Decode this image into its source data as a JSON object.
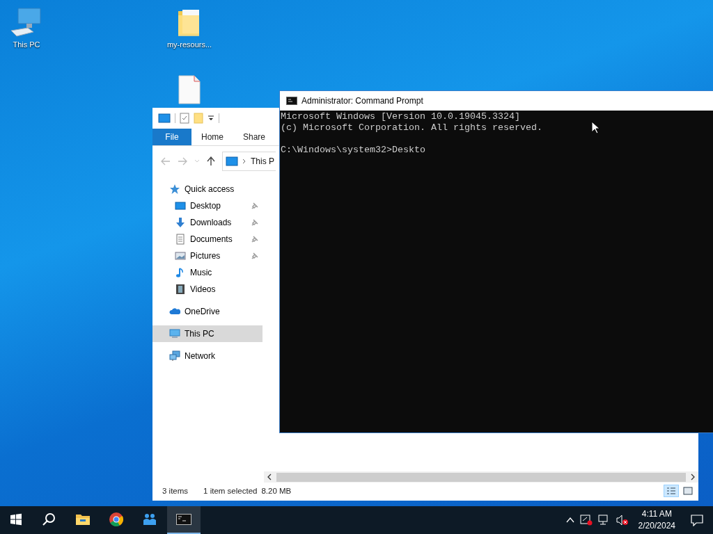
{
  "desktop_icons": [
    {
      "kind": "computer",
      "label": "This PC"
    },
    {
      "kind": "folder",
      "label": "my-resours..."
    },
    {
      "kind": "file"
    }
  ],
  "explorer": {
    "ribbon_tabs": [
      {
        "label": "File",
        "selected": true
      },
      {
        "label": "Home",
        "selected": false
      },
      {
        "label": "Share",
        "selected": false
      }
    ],
    "address": {
      "crumb": "This P"
    },
    "nav_tree": [
      {
        "kind": "star",
        "label": "Quick access",
        "children": [
          {
            "kind": "desktop",
            "label": "Desktop",
            "pinned": true
          },
          {
            "kind": "download",
            "label": "Downloads",
            "pinned": true
          },
          {
            "kind": "document",
            "label": "Documents",
            "pinned": true
          },
          {
            "kind": "pictures",
            "label": "Pictures",
            "pinned": true
          },
          {
            "kind": "music",
            "label": "Music",
            "pinned": false
          },
          {
            "kind": "video",
            "label": "Videos",
            "pinned": false
          }
        ]
      },
      {
        "kind": "cloud",
        "label": "OneDrive",
        "selected": false
      },
      {
        "kind": "pc",
        "label": "This PC",
        "selected": true
      },
      {
        "kind": "network",
        "label": "Network",
        "selected": false
      }
    ],
    "status_bar": {
      "count": "3 items",
      "selection": "1 item selected",
      "size": "8.20 MB"
    },
    "view_buttons": [
      {
        "kind": "details",
        "selected": true
      },
      {
        "kind": "large",
        "selected": false
      }
    ]
  },
  "command_prompt": {
    "title": "Administrator: Command Prompt",
    "output": [
      "Microsoft Windows [Version 10.0.19045.3324]",
      "(c) Microsoft Corporation. All rights reserved."
    ],
    "prompt": "C:\\Windows\\system32>Deskto"
  },
  "taskbar": {
    "apps": [
      {
        "kind": "start",
        "active": false
      },
      {
        "kind": "search",
        "active": false
      },
      {
        "kind": "explorer",
        "active": false
      },
      {
        "kind": "chrome",
        "active": false
      },
      {
        "kind": "people",
        "active": false
      },
      {
        "kind": "terminal",
        "active": true
      }
    ],
    "tray": {
      "time": "4:11 AM",
      "date": "2/20/2024"
    }
  }
}
